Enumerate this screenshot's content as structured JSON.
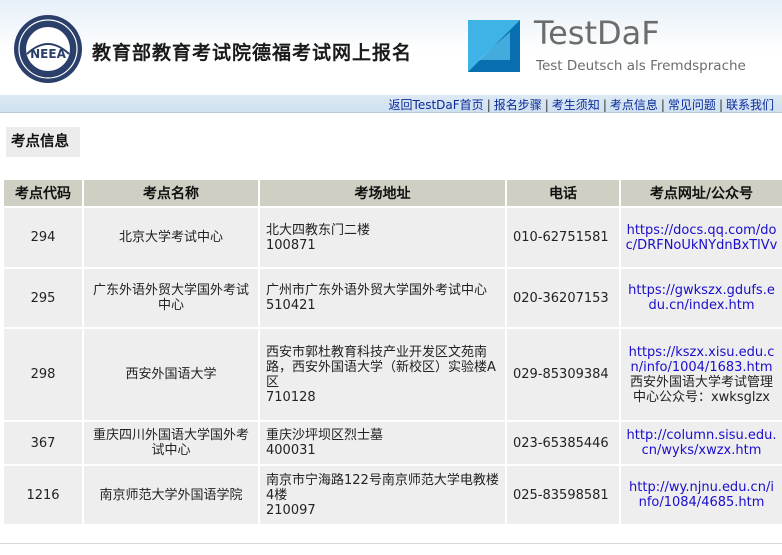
{
  "header": {
    "logo_text": "NEEA",
    "site_title": "教育部教育考试院德福考试网上报名",
    "testdaf_name": "TestDaF",
    "testdaf_subtitle": "Test Deutsch als Fremdsprache"
  },
  "nav": {
    "items": [
      {
        "label": "返回TestDaF首页"
      },
      {
        "label": "报名步骤"
      },
      {
        "label": "考生须知"
      },
      {
        "label": "考点信息"
      },
      {
        "label": "常见问题"
      },
      {
        "label": "联系我们"
      }
    ],
    "separator": "|"
  },
  "section": {
    "title": "考点信息"
  },
  "table": {
    "headers": [
      "考点代码",
      "考点名称",
      "考场地址",
      "电话",
      "考点网址/公众号"
    ],
    "rows": [
      {
        "code": "294",
        "name": "北京大学考试中心",
        "addr": "北大四教东门二楼",
        "zip": "100871",
        "phone": "010-62751581",
        "url": "https://docs.qq.com/doc/DRFNoUkNYdnBxTlVv",
        "note": ""
      },
      {
        "code": "295",
        "name": "广东外语外贸大学国外考试中心",
        "addr": "广州市广东外语外贸大学国外考试中心",
        "zip": "510421",
        "phone": "020-36207153",
        "url": "https://gwkszx.gdufs.edu.cn/index.htm",
        "note": ""
      },
      {
        "code": "298",
        "name": "西安外国语大学",
        "addr": "西安市郭杜教育科技产业开发区文苑南路，西安外国语大学（新校区）实验楼A区",
        "zip": "710128",
        "phone": "029-85309384",
        "url": "https://kszx.xisu.edu.cn/info/1004/1683.htm",
        "note": "西安外国语大学考试管理中心公众号：xwksglzx"
      },
      {
        "code": "367",
        "name": "重庆四川外国语大学国外考试中心",
        "addr": "重庆沙坪坝区烈士墓",
        "zip": "400031",
        "phone": "023-65385446",
        "url": "http://column.sisu.edu.cn/wyks/xwzx.htm",
        "note": ""
      },
      {
        "code": "1216",
        "name": "南京师范大学外国语学院",
        "addr": "南京市宁海路122号南京师范大学电教楼4楼",
        "zip": "210097",
        "phone": "025-83598581",
        "url": "http://wy.njnu.edu.cn/info/1084/4685.htm",
        "note": ""
      }
    ]
  },
  "colors": {
    "header_th": "#cfcfc3",
    "cell_bg": "#eeeeee",
    "link": "#1a0dcc",
    "nav_link": "#0a2a9a"
  }
}
